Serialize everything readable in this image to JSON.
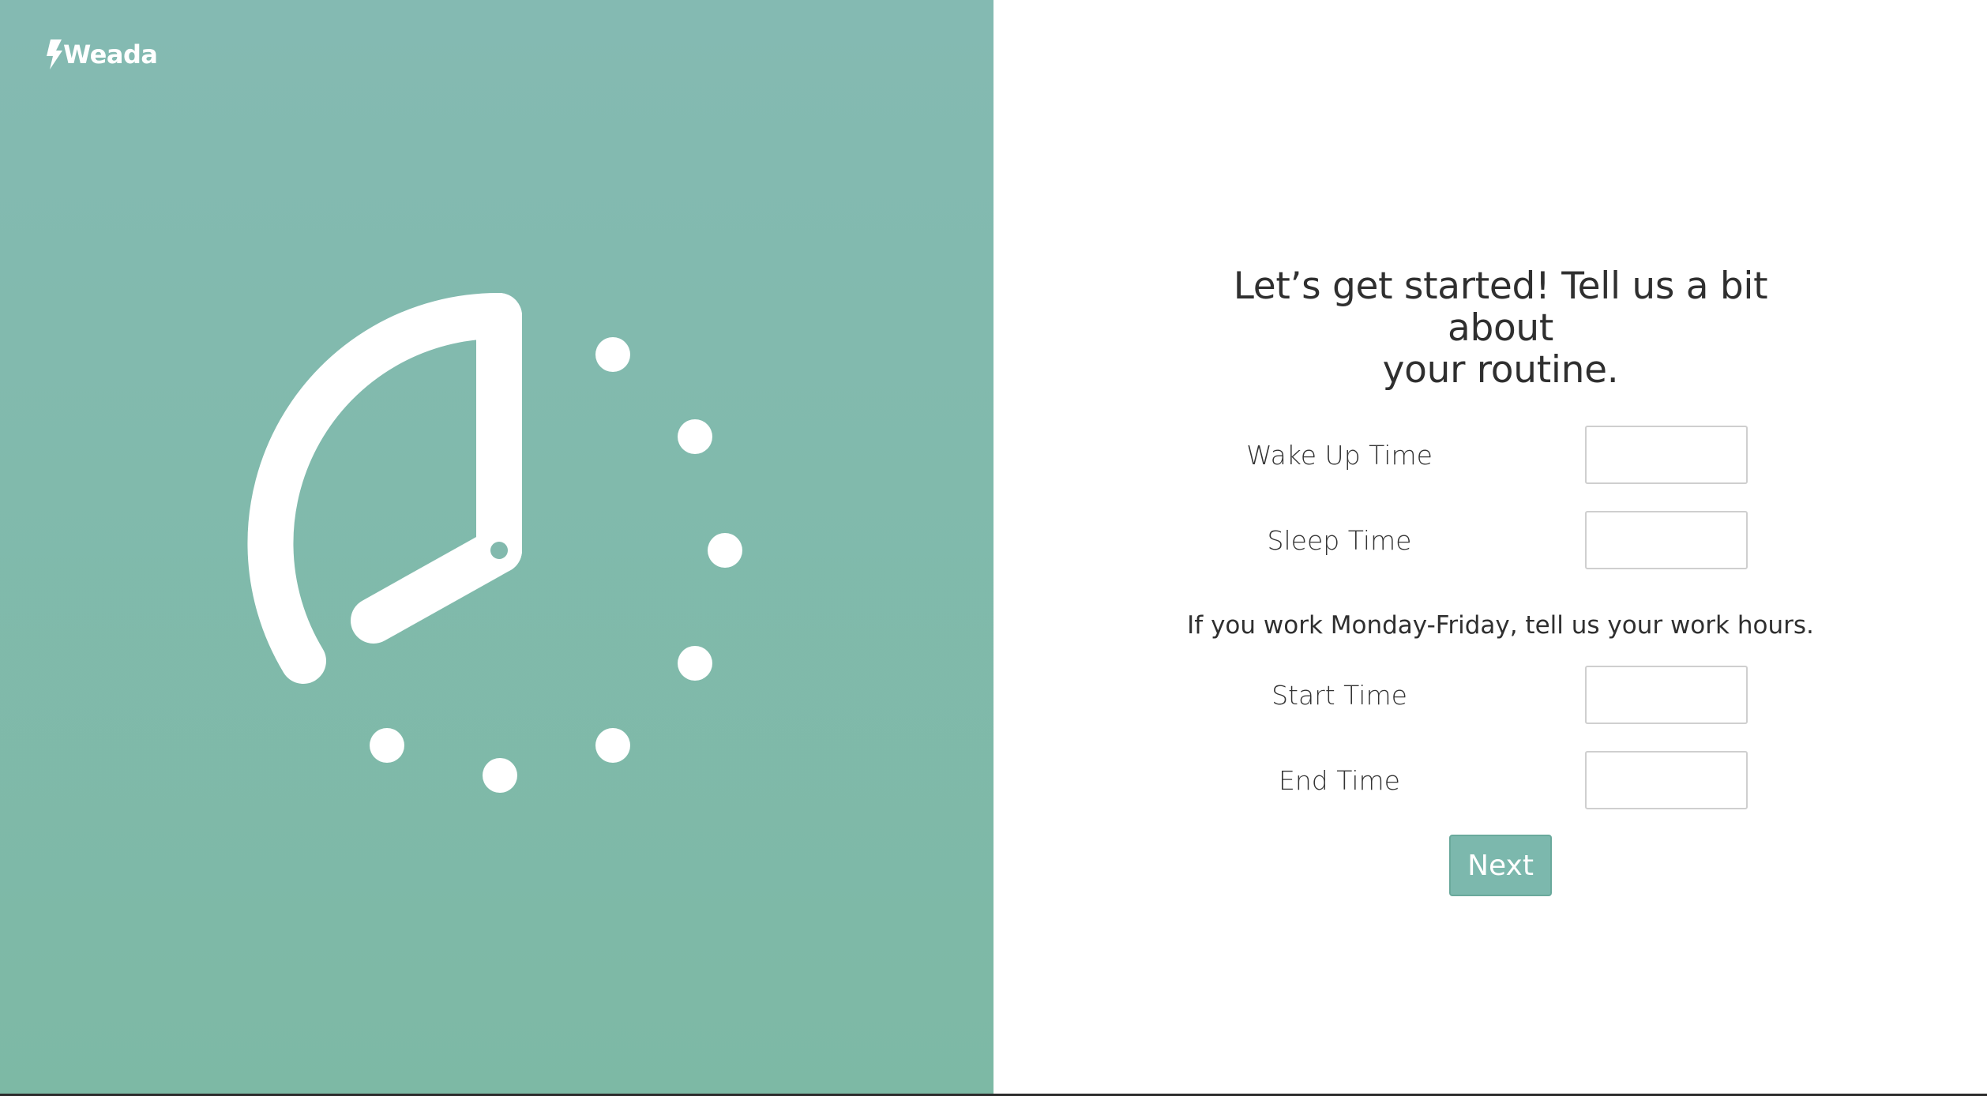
{
  "brand": {
    "name": "Weada",
    "icon": "lightning-bolt-icon"
  },
  "hero": {
    "illustration": "clock-icon",
    "background_color": "#84bab2",
    "foreground_color": "#ffffff"
  },
  "form": {
    "headline_line1": "Let’s get started! Tell us a bit about",
    "headline_line2": "your routine.",
    "routine_fields": [
      {
        "label": "Wake Up Time",
        "value": ""
      },
      {
        "label": "Sleep Time",
        "value": ""
      }
    ],
    "work_prompt": "If you work Monday-Friday, tell us your work hours.",
    "work_fields": [
      {
        "label": "Start Time",
        "value": ""
      },
      {
        "label": "End Time",
        "value": ""
      }
    ],
    "next_label": "Next",
    "accent_color": "#7cb8ad"
  }
}
